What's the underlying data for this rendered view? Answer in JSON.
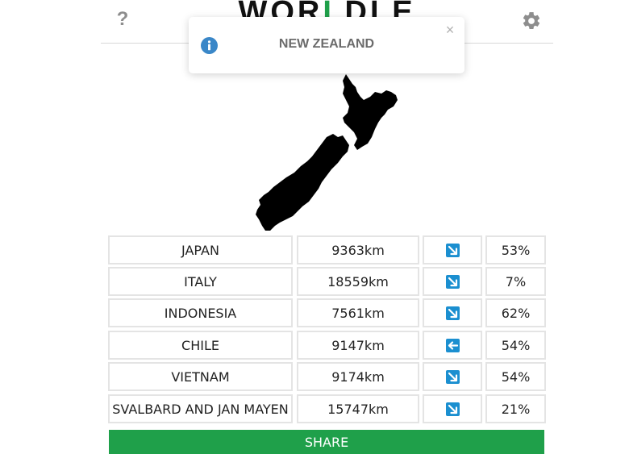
{
  "header": {
    "title_prefix": "WOR",
    "title_accent": "L",
    "title_suffix": "DLE",
    "help_label": "?",
    "accent_color": "#1fa04a"
  },
  "toast": {
    "message": "NEW ZEALAND",
    "icon": "info-icon",
    "close_label": "×"
  },
  "map": {
    "icon": "new-zealand-silhouette"
  },
  "guesses": [
    {
      "country": "JAPAN",
      "distance": "9363km",
      "direction": "down-right",
      "proximity": "53%"
    },
    {
      "country": "ITALY",
      "distance": "18559km",
      "direction": "down-right",
      "proximity": "7%"
    },
    {
      "country": "INDONESIA",
      "distance": "7561km",
      "direction": "down-right",
      "proximity": "62%"
    },
    {
      "country": "CHILE",
      "distance": "9147km",
      "direction": "left",
      "proximity": "54%"
    },
    {
      "country": "VIETNAM",
      "distance": "9174km",
      "direction": "down-right",
      "proximity": "54%"
    },
    {
      "country": "SVALBARD AND JAN MAYEN",
      "distance": "15747km",
      "direction": "down-right",
      "proximity": "21%"
    }
  ],
  "share": {
    "label": "SHARE",
    "color": "#1fa04a"
  },
  "arrow_color": "#1b8fd0"
}
